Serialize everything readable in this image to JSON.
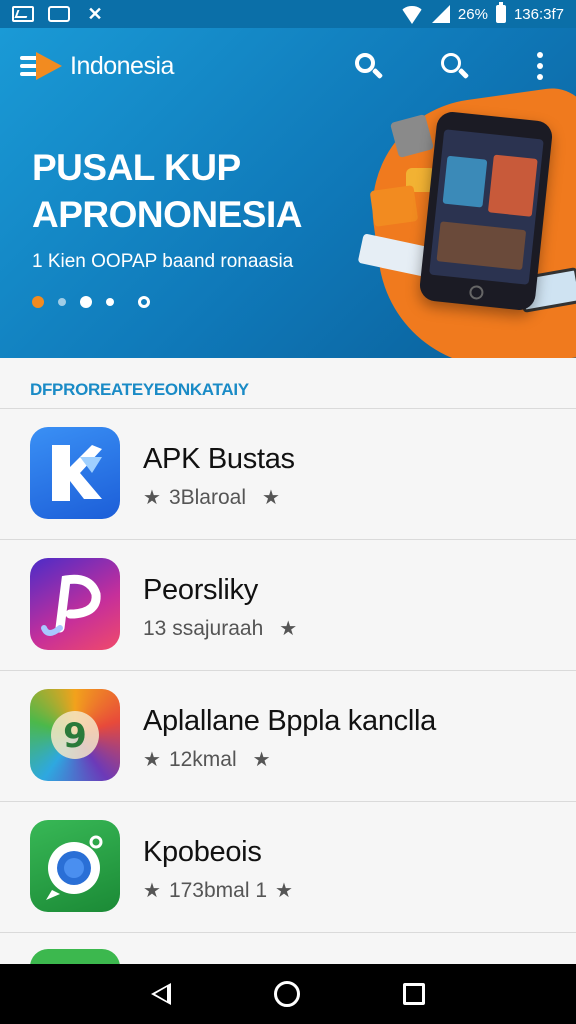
{
  "status_bar": {
    "battery_text": "26%",
    "time": "136:3f7",
    "icons": [
      "gallery-icon",
      "message-icon",
      "x-icon",
      "wifi-icon",
      "signal-icon",
      "battery-icon"
    ]
  },
  "header": {
    "logo_text": "Indonesia",
    "icons": [
      "search-icon",
      "search-alt-icon",
      "more-vert-icon"
    ]
  },
  "banner": {
    "line1": "PUSAL KUP",
    "line2": "APRONONESIA",
    "subtitle": "1 Kien OOPAP baand ronaasia",
    "pager_count": 5,
    "pager_active_index": 0
  },
  "section": {
    "title": "DFPROREATEYEONKATAIY"
  },
  "apps": [
    {
      "name": "APK Bustas",
      "meta": "3Blaroal",
      "lead_star": true,
      "trail_star": true,
      "icon": "k-app-icon",
      "colors": [
        "#2f7ff0",
        "#1c5ed8"
      ]
    },
    {
      "name": "Peorsliky",
      "meta": "13 ssajuraah",
      "lead_star": false,
      "trail_star": true,
      "icon": "p-app-icon",
      "colors": [
        "#6a2bd8",
        "#e03a8c"
      ]
    },
    {
      "name": "Aplallane Bppla kanclla",
      "meta": "12kmal",
      "lead_star": true,
      "trail_star": true,
      "icon": "multicolor-app-icon",
      "colors": [
        "#f2a21c",
        "#6c3ab8"
      ]
    },
    {
      "name": "Kpobeois",
      "meta": "173bmal 1",
      "lead_star": true,
      "trail_star": true,
      "icon": "camera-app-icon",
      "colors": [
        "#2ea84a",
        "#1b8a36"
      ]
    }
  ],
  "colors": {
    "brand_blue": "#1a9ad6",
    "accent_orange": "#f07a1e",
    "section_title": "#1a8bc6"
  }
}
